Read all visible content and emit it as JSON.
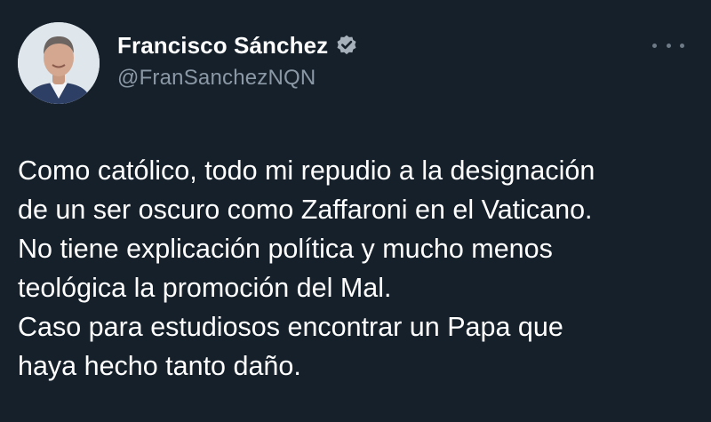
{
  "author": {
    "name": "Francisco Sánchez",
    "handle": "@FranSanchezNQN",
    "verified": true
  },
  "tweet": {
    "lines": [
      "Como católico, todo mi repudio a la designación",
      "de un ser oscuro como Zaffaroni en el Vaticano.",
      "No tiene explicación política y mucho menos",
      "teológica la promoción del Mal.",
      "Caso para estudiosos encontrar un Papa que",
      "haya hecho tanto daño."
    ]
  },
  "icons": {
    "verified": "verified-badge-icon",
    "more": "more-options-icon"
  },
  "colors": {
    "background": "#15202b",
    "text": "#ffffff",
    "secondary_text": "#8b98a5",
    "verified_badge": "#a7b1bb"
  }
}
